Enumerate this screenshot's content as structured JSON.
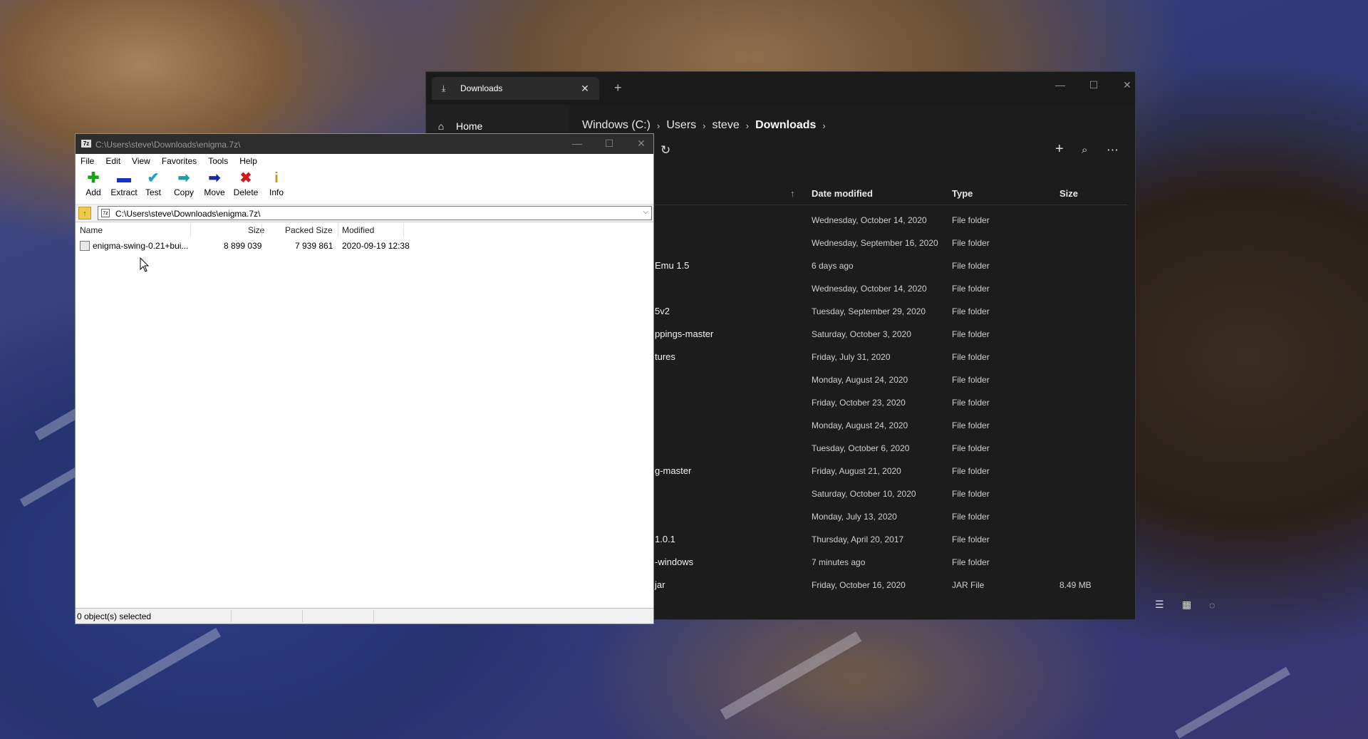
{
  "files_window": {
    "tab_label": "Downloads",
    "tab_icon": "download-icon",
    "sidebar": {
      "home_label": "Home"
    },
    "breadcrumb": [
      "Windows (C:)",
      "Users",
      "steve",
      "Downloads"
    ],
    "columns": {
      "date": "Date modified",
      "type": "Type",
      "size": "Size"
    },
    "rows": [
      {
        "name": "",
        "date": "Wednesday, October 14, 2020",
        "type": "File folder",
        "size": ""
      },
      {
        "name": "",
        "date": "Wednesday, September 16, 2020",
        "type": "File folder",
        "size": ""
      },
      {
        "name": "Emu 1.5",
        "date": "6 days ago",
        "type": "File folder",
        "size": ""
      },
      {
        "name": "",
        "date": "Wednesday, October 14, 2020",
        "type": "File folder",
        "size": ""
      },
      {
        "name": "5v2",
        "date": "Tuesday, September 29, 2020",
        "type": "File folder",
        "size": ""
      },
      {
        "name": "ppings-master",
        "date": "Saturday, October 3, 2020",
        "type": "File folder",
        "size": ""
      },
      {
        "name": "tures",
        "date": "Friday, July 31, 2020",
        "type": "File folder",
        "size": ""
      },
      {
        "name": "",
        "date": "Monday, August 24, 2020",
        "type": "File folder",
        "size": ""
      },
      {
        "name": "",
        "date": "Friday, October 23, 2020",
        "type": "File folder",
        "size": ""
      },
      {
        "name": "",
        "date": "Monday, August 24, 2020",
        "type": "File folder",
        "size": ""
      },
      {
        "name": "",
        "date": "Tuesday, October 6, 2020",
        "type": "File folder",
        "size": ""
      },
      {
        "name": "g-master",
        "date": "Friday, August 21, 2020",
        "type": "File folder",
        "size": ""
      },
      {
        "name": "",
        "date": "Saturday, October 10, 2020",
        "type": "File folder",
        "size": ""
      },
      {
        "name": "",
        "date": "Monday, July 13, 2020",
        "type": "File folder",
        "size": ""
      },
      {
        "name": "1.0.1",
        "date": "Thursday, April 20, 2017",
        "type": "File folder",
        "size": ""
      },
      {
        "name": "-windows",
        "date": "7 minutes ago",
        "type": "File folder",
        "size": ""
      },
      {
        "name": "jar",
        "date": "Friday, October 16, 2020",
        "type": "JAR File",
        "size": "8.49 MB"
      }
    ]
  },
  "sevenzip_window": {
    "title": "C:\\Users\\steve\\Downloads\\enigma.7z\\",
    "app_icon_text": "7z",
    "menu": [
      "File",
      "Edit",
      "View",
      "Favorites",
      "Tools",
      "Help"
    ],
    "toolbar": [
      {
        "label": "Add",
        "icon": "plus-icon",
        "glyph": "✚",
        "color": "#1aa11a"
      },
      {
        "label": "Extract",
        "icon": "minus-icon",
        "glyph": "▬",
        "color": "#1432c8"
      },
      {
        "label": "Test",
        "icon": "check-icon",
        "glyph": "✔",
        "color": "#19a8c0"
      },
      {
        "label": "Copy",
        "icon": "copy-arrow-icon",
        "glyph": "➡",
        "color": "#1aa0a0"
      },
      {
        "label": "Move",
        "icon": "move-arrow-icon",
        "glyph": "➡",
        "color": "#1a2a9a"
      },
      {
        "label": "Delete",
        "icon": "delete-x-icon",
        "glyph": "✖",
        "color": "#d01818"
      },
      {
        "label": "Info",
        "icon": "info-icon",
        "glyph": "i",
        "color": "#c89a10"
      }
    ],
    "address": "C:\\Users\\steve\\Downloads\\enigma.7z\\",
    "columns": {
      "name": "Name",
      "size": "Size",
      "packed": "Packed Size",
      "modified": "Modified"
    },
    "rows": [
      {
        "name": "enigma-swing-0.21+bui...",
        "size": "8 899 039",
        "packed": "7 939 861",
        "modified": "2020-09-19 12:38"
      }
    ],
    "status": "0 object(s) selected"
  }
}
